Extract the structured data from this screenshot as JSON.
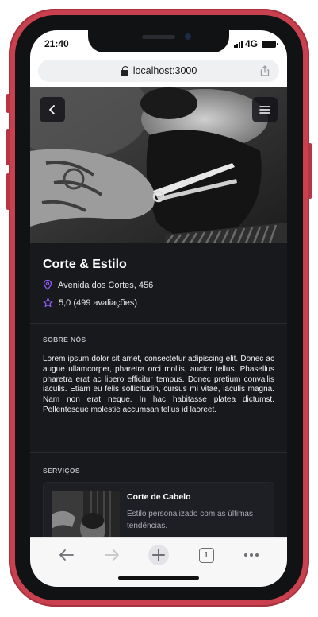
{
  "status_bar": {
    "time": "21:40",
    "network": "4G"
  },
  "browser": {
    "url": "localhost:3000"
  },
  "shop": {
    "name": "Corte & Estilo",
    "address": "Avenida dos Cortes, 456",
    "rating": "5,0 (499 avaliações)"
  },
  "about": {
    "label": "SOBRE NÓS",
    "text": "Lorem ipsum dolor sit amet, consectetur adipiscing elit. Donec ac augue ullamcorper, pharetra orci mollis, auctor tellus. Phasellus pharetra erat ac libero efficitur tempus. Donec pretium convallis iaculis. Etiam eu felis sollicitudin, cursus mi vitae, iaculis magna. Nam non erat neque. In hac habitasse platea dictumst. Pellentesque molestie accumsan tellus id laoreet."
  },
  "services": {
    "label": "SERVIÇOS",
    "items": [
      {
        "name": "Corte de Cabelo",
        "description": "Estilo personalizado com as últimas tendências."
      }
    ]
  },
  "toolbar": {
    "tab_count": "1"
  },
  "colors": {
    "accent": "#8b5cf6",
    "background": "#18191d",
    "frame": "#c9414f"
  }
}
